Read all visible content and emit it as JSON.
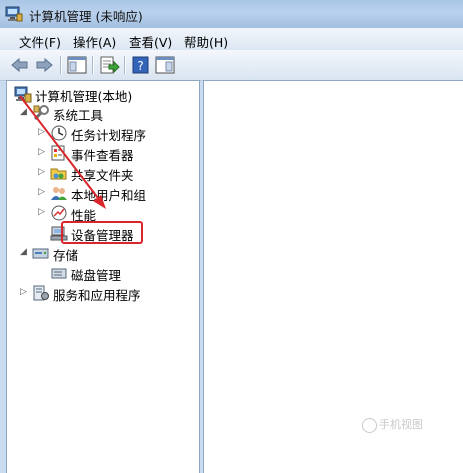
{
  "window": {
    "title": "计算机管理 (未响应)"
  },
  "menu": {
    "file": "文件(F)",
    "action": "操作(A)",
    "view": "查看(V)",
    "help": "帮助(H)"
  },
  "tree": {
    "root": "计算机管理(本地)",
    "system_tools": "系统工具",
    "task_scheduler": "任务计划程序",
    "event_viewer": "事件查看器",
    "shared_folders": "共享文件夹",
    "local_users": "本地用户和组",
    "performance": "性能",
    "device_manager": "设备管理器",
    "storage": "存储",
    "disk_management": "磁盘管理",
    "services_apps": "服务和应用程序"
  },
  "annotation": {
    "arrow_color": "#d8262c",
    "box_color": "#d8262c"
  },
  "watermark": {
    "text": "手机视图"
  }
}
